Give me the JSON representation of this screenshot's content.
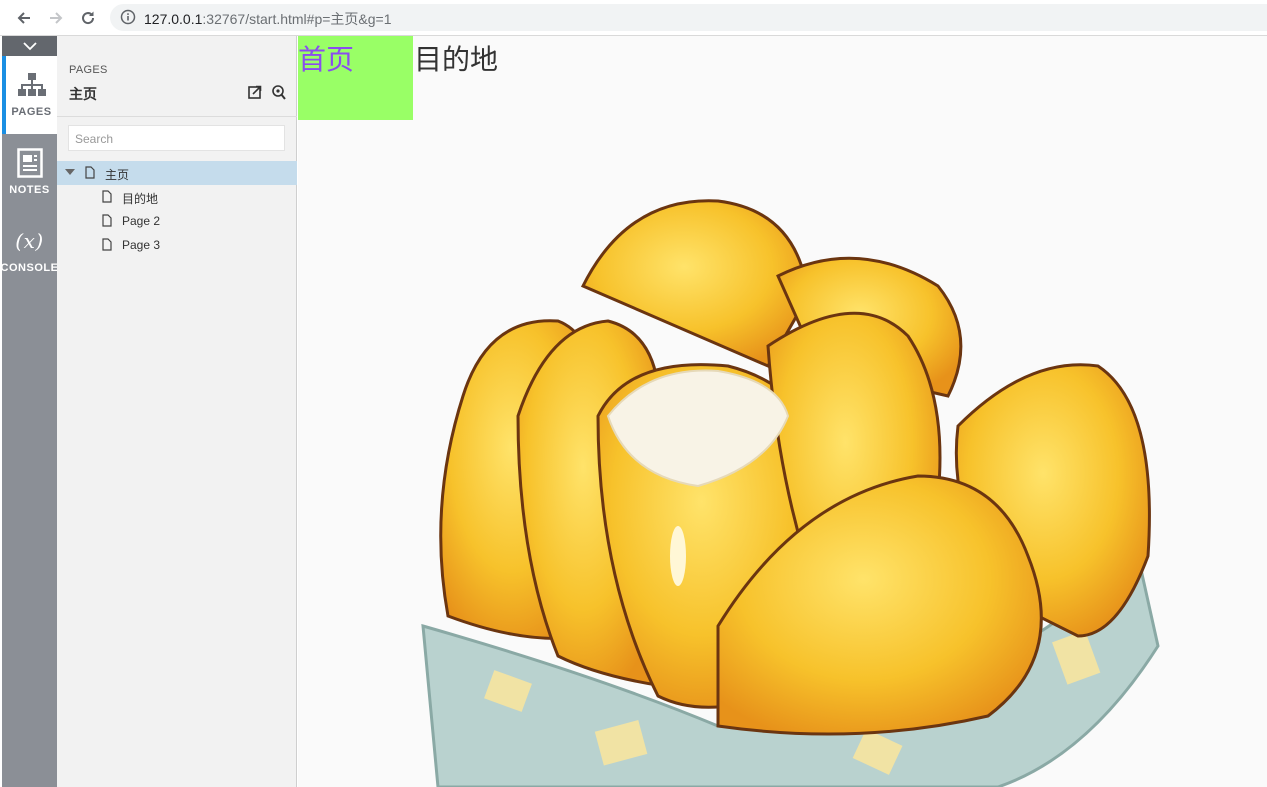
{
  "browser": {
    "url_host": "127.0.0.1",
    "url_rest": ":32767/start.html#p=主页&g=1"
  },
  "rail": {
    "items": [
      {
        "label": "PAGES",
        "icon": "sitemap-icon"
      },
      {
        "label": "NOTES",
        "icon": "notes-icon"
      },
      {
        "label": "CONSOLE",
        "icon": "variable-icon",
        "glyph": "(x)"
      }
    ]
  },
  "panel": {
    "caption": "PAGES",
    "title": "主页",
    "search_placeholder": "Search",
    "tree": [
      {
        "label": "主页",
        "selected": true
      },
      {
        "label": "目的地"
      },
      {
        "label": "Page 2"
      },
      {
        "label": "Page 3"
      }
    ]
  },
  "canvas": {
    "home_link": "首页",
    "destination_link": "目的地",
    "image_alt": "golden pastry buns in a paper box illustration"
  },
  "colors": {
    "home_bg": "#99ff66",
    "home_text": "#8a4cf0",
    "rail_bg": "#8b8f96",
    "accent": "#1a8fe3",
    "tree_selected": "#c5dcec"
  }
}
